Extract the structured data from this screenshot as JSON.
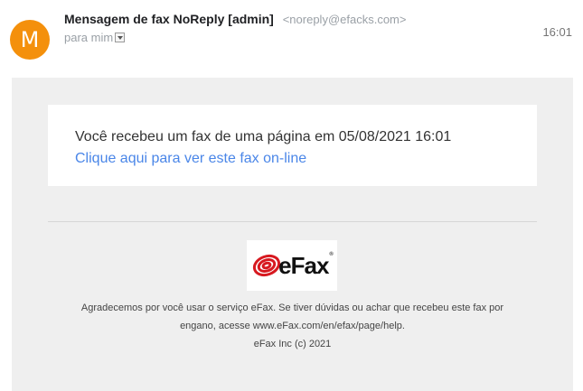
{
  "header": {
    "avatar_letter": "M",
    "sender_name": "Mensagem de fax NoReply [admin]",
    "sender_email": "<noreply@efacks.com>",
    "recipient": "para mim",
    "time": "16:01"
  },
  "message": {
    "text": "Você recebeu um fax de uma página em 05/08/2021 16:01",
    "link_text": "Clique aqui para ver este fax on-line"
  },
  "logo": {
    "text": "eFax",
    "registered": "®"
  },
  "footer": {
    "line1": "Agradecemos por você usar o serviço eFax. Se tiver dúvidas ou achar que recebeu este fax por",
    "line2": "engano, acesse www.eFax.com/en/efax/page/help.",
    "line3": "eFax Inc (c) 2021"
  },
  "colors": {
    "avatar": "#f4900c",
    "link": "#4a86e8",
    "logo_red": "#d71920",
    "panel_bg": "#efefef"
  }
}
